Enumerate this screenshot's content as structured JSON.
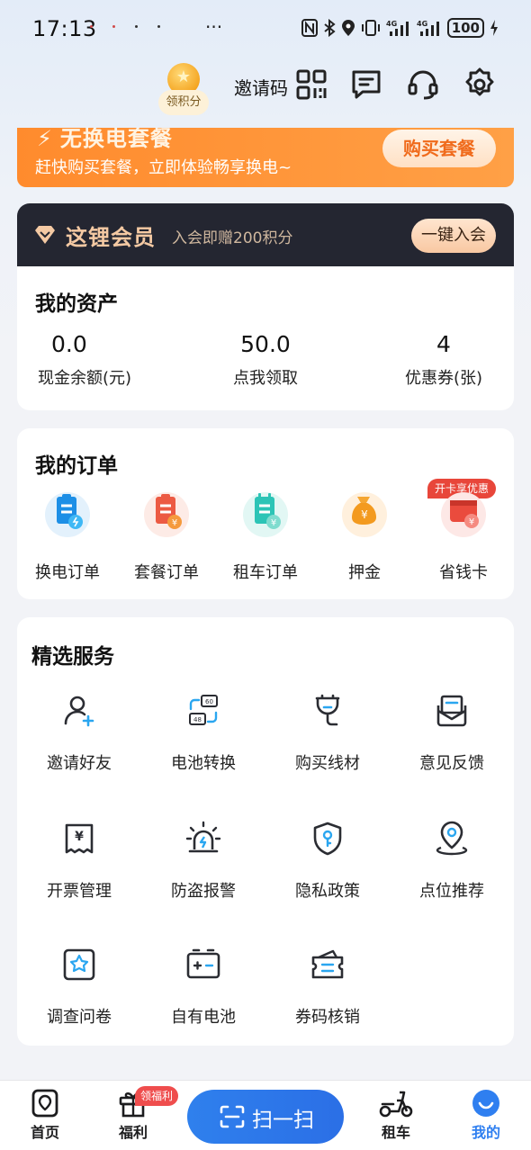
{
  "status_bar": {
    "time": "17:13",
    "battery": "100",
    "network_1": "4G",
    "network_2": "4G"
  },
  "header": {
    "points_label": "领积分",
    "invite_code_label": "邀请码",
    "icons": [
      "qrcode-icon",
      "message-icon",
      "headset-icon",
      "settings-icon"
    ]
  },
  "promo": {
    "title": "无换电套餐",
    "subtitle": "赶快购买套餐，立即体验畅享换电~",
    "button": "购买套餐"
  },
  "member": {
    "title": "这锂会员",
    "subtitle": "入会即赠200积分",
    "button": "一键入会"
  },
  "assets": {
    "title": "我的资产",
    "items": [
      {
        "value": "0.0",
        "label": "现金余额(元)"
      },
      {
        "value": "50.0",
        "label": "点我领取"
      },
      {
        "value": "4",
        "label": "优惠券(张)"
      }
    ]
  },
  "orders": {
    "title": "我的订单",
    "badge": "开卡享优惠",
    "items": [
      {
        "label": "换电订单",
        "icon": "swap-order-icon"
      },
      {
        "label": "套餐订单",
        "icon": "package-order-icon"
      },
      {
        "label": "租车订单",
        "icon": "rental-order-icon"
      },
      {
        "label": "押金",
        "icon": "deposit-icon"
      },
      {
        "label": "省钱卡",
        "icon": "saving-card-icon"
      }
    ]
  },
  "services": {
    "title": "精选服务",
    "items": [
      {
        "label": "邀请好友",
        "icon": "invite-friend-icon"
      },
      {
        "label": "电池转换",
        "icon": "battery-convert-icon"
      },
      {
        "label": "购买线材",
        "icon": "cable-icon"
      },
      {
        "label": "意见反馈",
        "icon": "feedback-icon"
      },
      {
        "label": "开票管理",
        "icon": "invoice-icon"
      },
      {
        "label": "防盗报警",
        "icon": "alarm-icon"
      },
      {
        "label": "隐私政策",
        "icon": "privacy-icon"
      },
      {
        "label": "点位推荐",
        "icon": "location-recommend-icon"
      },
      {
        "label": "调查问卷",
        "icon": "survey-icon"
      },
      {
        "label": "自有电池",
        "icon": "own-battery-icon"
      },
      {
        "label": "券码核销",
        "icon": "coupon-verify-icon"
      }
    ]
  },
  "nav": {
    "home": "首页",
    "welfare": "福利",
    "welfare_badge": "领福利",
    "scan": "扫一扫",
    "rental": "租车",
    "mine": "我的",
    "active_color": "#2f7ff0"
  }
}
